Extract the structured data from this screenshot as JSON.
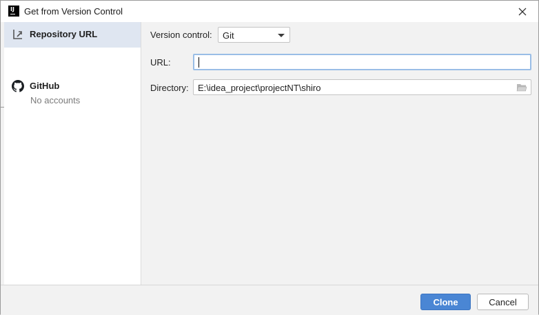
{
  "window": {
    "title": "Get from Version Control",
    "app_icon": "intellij-idea-icon",
    "close_icon": "close-icon"
  },
  "sidebar": {
    "items": [
      {
        "label": "Repository URL",
        "icon": "repository-url-icon",
        "selected": true
      },
      {
        "label": "GitHub",
        "icon": "github-icon",
        "sub": "No accounts",
        "selected": false
      }
    ]
  },
  "form": {
    "vcs_label": "Version control:",
    "vcs_value": "Git",
    "url_label": "URL:",
    "url_value": "",
    "directory_label": "Directory:",
    "directory_value": "E:\\idea_project\\projectNT\\shiro",
    "folder_icon": "folder-icon"
  },
  "buttons": {
    "clone": "Clone",
    "cancel": "Cancel"
  },
  "colors": {
    "accent": "#4a86d4",
    "selected_bg": "#dfe6f1",
    "focus_border": "#99bde6"
  }
}
